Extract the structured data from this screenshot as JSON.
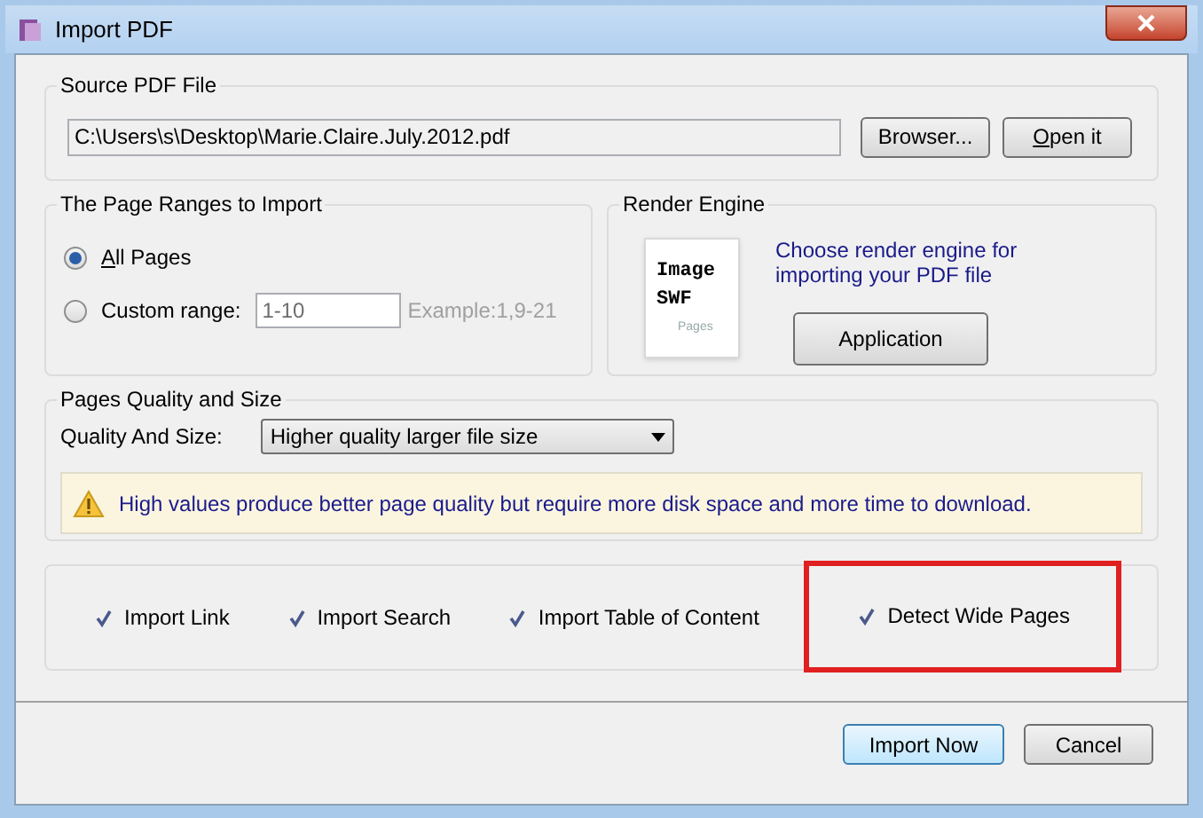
{
  "window": {
    "title": "Import PDF"
  },
  "source": {
    "title": "Source PDF File",
    "path": "C:\\Users\\s\\Desktop\\Marie.Claire.July.2012.pdf",
    "buttons": [
      {
        "label": "Browser...",
        "mnemonic": false
      },
      {
        "label": "Open it",
        "mnemonic": true
      }
    ]
  },
  "page_ranges": {
    "title": "The Page Ranges to Import",
    "options": [
      {
        "label": "All Pages",
        "selected": true,
        "mnemonic": true
      },
      {
        "label": "Custom range:",
        "selected": false,
        "mnemonic": false
      }
    ],
    "range_value": "1-10",
    "example": "Example:1,9-21"
  },
  "render_engine": {
    "title": "Render Engine",
    "icon_lines": [
      "Image",
      "SWF"
    ],
    "icon_caption": "Pages",
    "description": "Choose render engine for importing your PDF file",
    "button": "Application"
  },
  "quality": {
    "title": "Pages Quality and Size",
    "label": "Quality And Size:",
    "value": "Higher quality larger file size",
    "warning": "High values produce better page quality but require more disk space and more time to download."
  },
  "options": [
    {
      "label": "Import Link",
      "checked": true,
      "highlighted": false
    },
    {
      "label": "Import Search",
      "checked": true,
      "highlighted": false
    },
    {
      "label": "Import Table of Content",
      "checked": true,
      "highlighted": false
    },
    {
      "label": "Detect Wide Pages",
      "checked": true,
      "highlighted": true
    }
  ],
  "buttons": [
    {
      "label": "Import Now",
      "default": true
    },
    {
      "label": "Cancel",
      "default": false
    }
  ]
}
